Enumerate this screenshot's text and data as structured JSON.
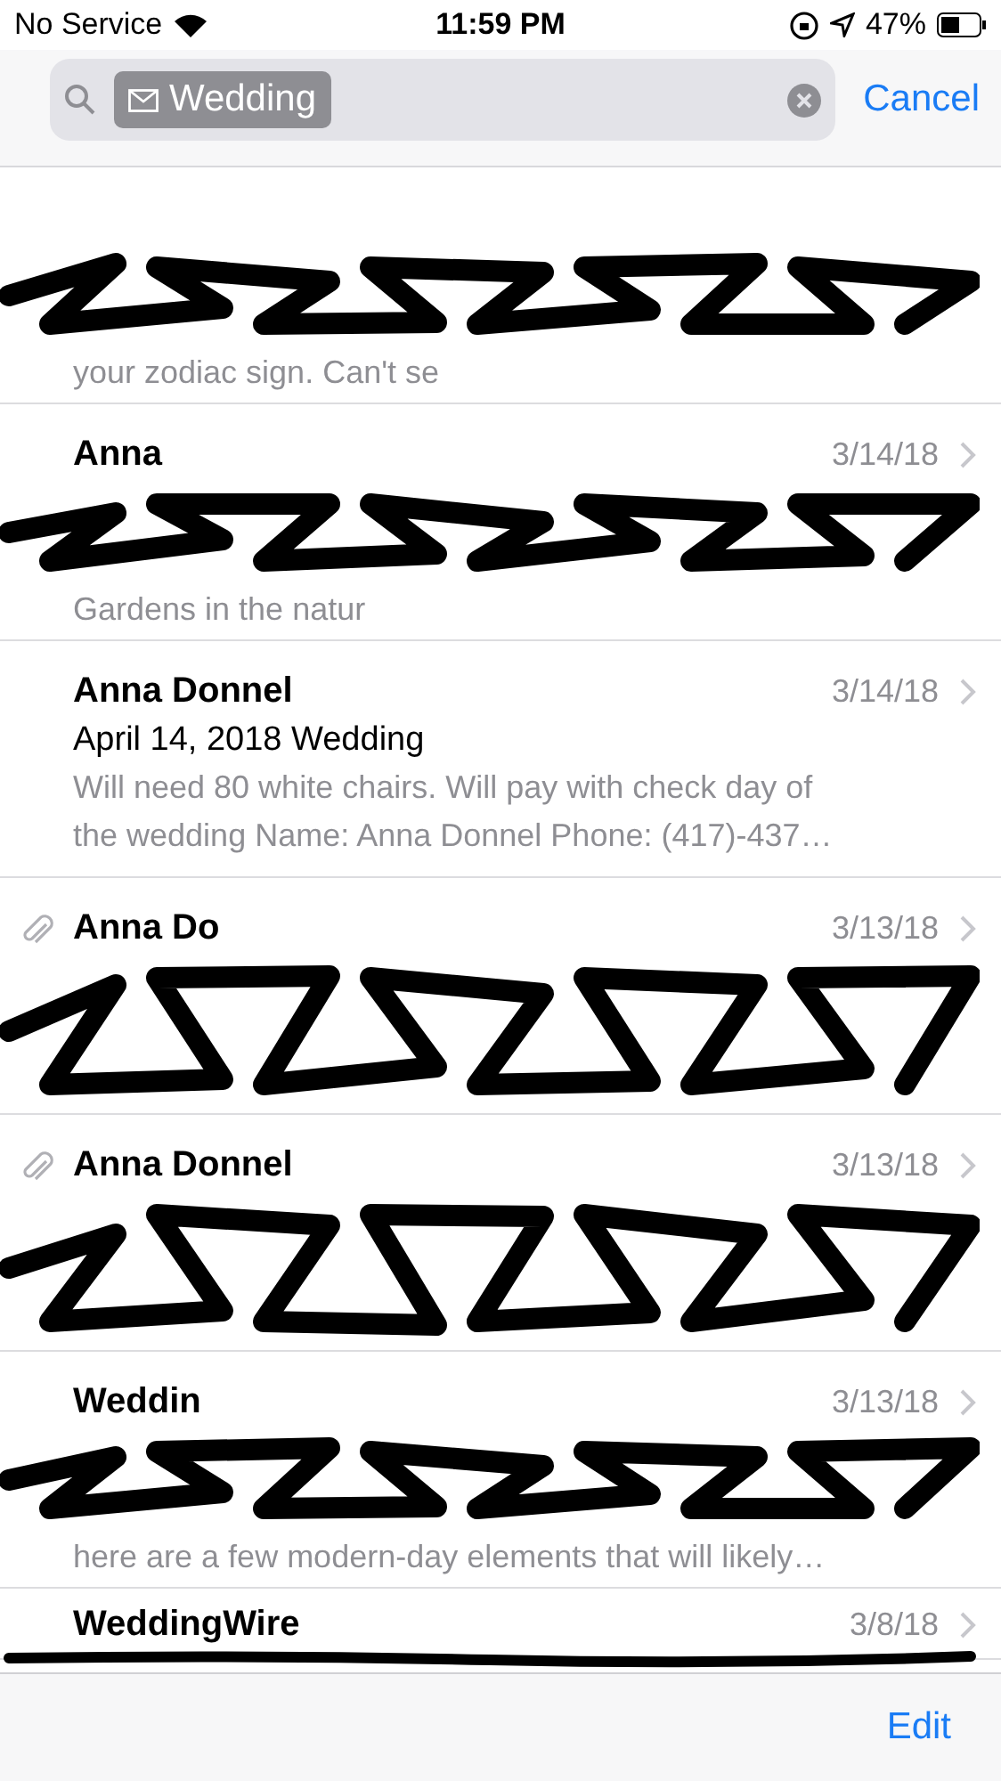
{
  "status_bar": {
    "carrier": "No Service",
    "time": "11:59 PM",
    "battery": "47%"
  },
  "search": {
    "token": "Wedding",
    "cancel": "Cancel"
  },
  "messages": [
    {
      "redacted": true,
      "attachment": false,
      "preview": "your zodiac sign. Can't se"
    },
    {
      "redacted": true,
      "attachment": false,
      "sender": "Anna",
      "date": "3/14/18",
      "preview": "Gardens in the natur"
    },
    {
      "redacted": false,
      "attachment": false,
      "sender": "Anna Donnel",
      "date": "3/14/18",
      "subject": "April 14, 2018 Wedding",
      "lines": [
        "Will need 80 white chairs. Will pay with check day of",
        "the wedding Name: Anna Donnel Phone: (417)-437…"
      ]
    },
    {
      "redacted": true,
      "attachment": true,
      "sender": "Anna Do",
      "date": "3/13/18"
    },
    {
      "redacted": true,
      "attachment": true,
      "sender": "Anna Donnel",
      "date": "3/13/18"
    },
    {
      "redacted": true,
      "attachment": false,
      "sender": "Weddin",
      "date": "3/13/18",
      "preview": "here are a few modern-day elements that will likely…"
    },
    {
      "redacted": true,
      "attachment": false,
      "sender": "WeddingWire",
      "date": "3/8/18"
    }
  ],
  "toolbar": {
    "edit": "Edit"
  }
}
